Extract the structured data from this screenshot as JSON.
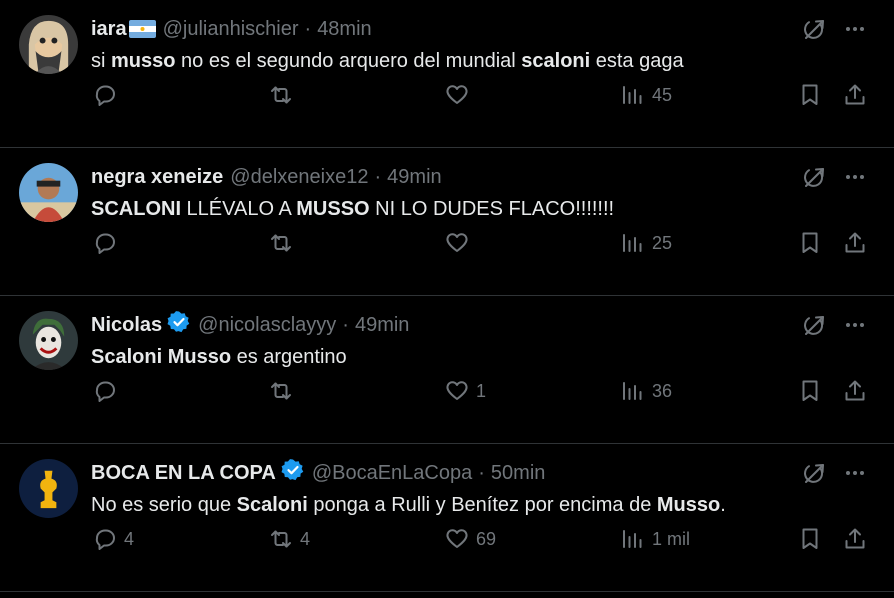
{
  "colors": {
    "background": "#000000",
    "text": "#e7e9ea",
    "muted": "#71767b",
    "verified": "#1d9bf0",
    "divider": "#2f3336"
  },
  "tweets": [
    {
      "name": "iara",
      "badge": "argentina-flag-icon",
      "handle": "@julianhischier",
      "time": "48min",
      "text": [
        "si ",
        {
          "b": "musso"
        },
        " no es el segundo arquero del mundial ",
        {
          "b": "scaloni"
        },
        " esta gaga"
      ],
      "replies": "",
      "retweets": "",
      "likes": "",
      "views": "45"
    },
    {
      "name": "negra xeneize",
      "badge": "",
      "handle": "@delxeneixe12",
      "time": "49min",
      "text": [
        {
          "b": "SCALONI"
        },
        " LLÉVALO A ",
        {
          "b": "MUSSO"
        },
        " NI LO DUDES FLACO!!!!!!!"
      ],
      "replies": "",
      "retweets": "",
      "likes": "",
      "views": "25"
    },
    {
      "name": "Nicolas",
      "badge": "verified-icon",
      "handle": "@nicolasclayyy",
      "time": "49min",
      "text": [
        {
          "b": "Scaloni Musso"
        },
        " es argentino"
      ],
      "replies": "",
      "retweets": "",
      "likes": "1",
      "views": "36"
    },
    {
      "name": "BOCA EN LA COPA",
      "badge": "verified-icon",
      "handle": "@BocaEnLaCopa",
      "time": "50min",
      "text": [
        "No es serio que ",
        {
          "b": "Scaloni"
        },
        " ponga a Rulli y Benítez por encima de ",
        {
          "b": "Musso"
        },
        "."
      ],
      "replies": "4",
      "retweets": "4",
      "likes": "69",
      "views": "1 mil"
    }
  ],
  "separator": "·"
}
